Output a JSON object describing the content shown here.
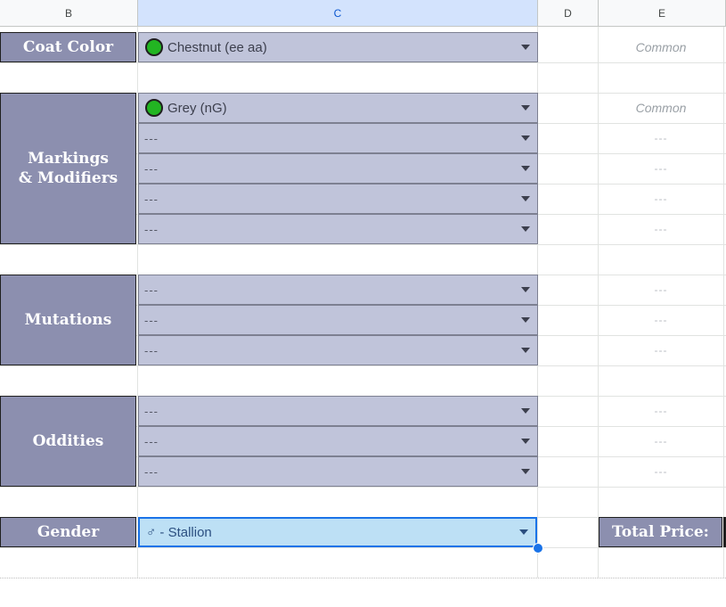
{
  "columns": [
    "B",
    "C",
    "D",
    "E"
  ],
  "sections": {
    "coat_color": {
      "label": "Coat Color",
      "rows": [
        {
          "value": "Chestnut (ee aa)",
          "rarity": "Common",
          "indicator_color": "#22b522"
        }
      ]
    },
    "markings": {
      "label": "Markings & Modifiers",
      "rows": [
        {
          "value": "Grey (nG)",
          "rarity": "Common",
          "indicator_color": "#22b522"
        },
        {
          "value": "---",
          "rarity": "---"
        },
        {
          "value": "---",
          "rarity": "---"
        },
        {
          "value": "---",
          "rarity": "---"
        },
        {
          "value": "---",
          "rarity": "---"
        }
      ]
    },
    "mutations": {
      "label": "Mutations",
      "rows": [
        {
          "value": "---",
          "rarity": "---"
        },
        {
          "value": "---",
          "rarity": "---"
        },
        {
          "value": "---",
          "rarity": "---"
        }
      ]
    },
    "oddities": {
      "label": "Oddities",
      "rows": [
        {
          "value": "---",
          "rarity": "---"
        },
        {
          "value": "---",
          "rarity": "---"
        },
        {
          "value": "---",
          "rarity": "---"
        }
      ]
    },
    "gender": {
      "label": "Gender",
      "value": "♂ - Stallion"
    }
  },
  "total_price_label": "Total Price:",
  "colors": {
    "category_fill": "#8c8faf",
    "dropdown_fill": "#c0c4da",
    "selected_fill": "#bde0f5",
    "selection_accent": "#1a73e8"
  }
}
